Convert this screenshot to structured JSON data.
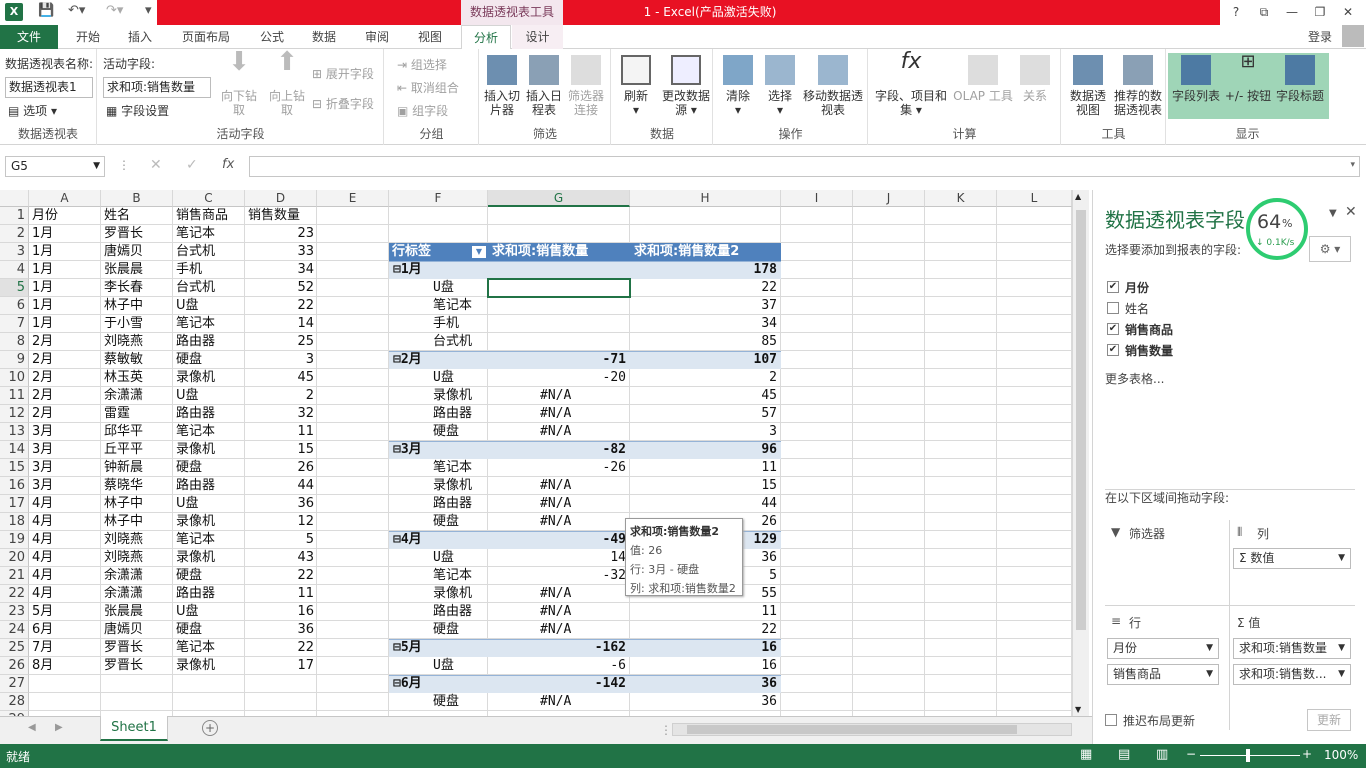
{
  "title": {
    "context_tools": "数据透视表工具",
    "window": "1 -   Excel(产品激活失败)",
    "login": "登录"
  },
  "tabs": [
    "文件",
    "开始",
    "插入",
    "页面布局",
    "公式",
    "数据",
    "审阅",
    "视图",
    "分析",
    "设计"
  ],
  "ribbon": {
    "pt_name_label": "数据透视表名称:",
    "pt_name_value": "数据透视表1",
    "options": "选项",
    "group_pivottable": "数据透视表",
    "active_field_label": "活动字段:",
    "active_field_value": "求和项:销售数量",
    "field_settings": "字段设置",
    "drill_down": "向下钻取",
    "drill_up": "向上钻取",
    "expand_field": "展开字段",
    "collapse_field": "折叠字段",
    "group_active_field": "活动字段",
    "group_selection": "组选择",
    "ungroup": "取消组合",
    "group_field": "组字段",
    "group_group": "分组",
    "insert_slicer": "插入切片器",
    "insert_timeline": "插入日程表",
    "filter_connections": "筛选器连接",
    "group_filter": "筛选",
    "refresh": "刷新",
    "change_source": "更改数据源",
    "group_data": "数据",
    "clear": "清除",
    "select": "选择",
    "move_pt": "移动数据透视表",
    "group_actions": "操作",
    "fields_items_sets": "字段、项目和集",
    "olap_tools": "OLAP 工具",
    "relationships": "关系",
    "group_calc": "计算",
    "pivotchart": "数据透视图",
    "recommended_pt": "推荐的数据透视表",
    "group_tools": "工具",
    "field_list": "字段列表",
    "buttons": "+/- 按钮",
    "field_headers": "字段标题",
    "group_show": "显示"
  },
  "formula_bar": {
    "name_box": "G5",
    "fx": "fx"
  },
  "columns": [
    "A",
    "B",
    "C",
    "D",
    "E",
    "F",
    "G",
    "H",
    "I",
    "J",
    "K",
    "L"
  ],
  "source_header": [
    "月份",
    "姓名",
    "销售商品",
    "销售数量"
  ],
  "source_rows": [
    [
      "1月",
      "罗晋长",
      "笔记本",
      "23"
    ],
    [
      "1月",
      "唐嫣贝",
      "台式机",
      "33"
    ],
    [
      "1月",
      "张晨晨",
      "手机",
      "34"
    ],
    [
      "1月",
      "李长春",
      "台式机",
      "52"
    ],
    [
      "1月",
      "林子中",
      "U盘",
      "22"
    ],
    [
      "1月",
      "于小雪",
      "笔记本",
      "14"
    ],
    [
      "2月",
      "刘晓燕",
      "路由器",
      "25"
    ],
    [
      "2月",
      "蔡敏敏",
      "硬盘",
      "3"
    ],
    [
      "2月",
      "林玉英",
      "录像机",
      "45"
    ],
    [
      "2月",
      "余潇潇",
      "U盘",
      "2"
    ],
    [
      "2月",
      "雷霆",
      "路由器",
      "32"
    ],
    [
      "3月",
      "邱华平",
      "笔记本",
      "11"
    ],
    [
      "3月",
      "丘平平",
      "录像机",
      "15"
    ],
    [
      "3月",
      "钟新晨",
      "硬盘",
      "26"
    ],
    [
      "3月",
      "蔡晓华",
      "路由器",
      "44"
    ],
    [
      "4月",
      "林子中",
      "U盘",
      "36"
    ],
    [
      "4月",
      "林子中",
      "录像机",
      "12"
    ],
    [
      "4月",
      "刘晓燕",
      "笔记本",
      "5"
    ],
    [
      "4月",
      "刘晓燕",
      "录像机",
      "43"
    ],
    [
      "4月",
      "余潇潇",
      "硬盘",
      "22"
    ],
    [
      "4月",
      "余潇潇",
      "路由器",
      "11"
    ],
    [
      "5月",
      "张晨晨",
      "U盘",
      "16"
    ],
    [
      "6月",
      "唐嫣贝",
      "硬盘",
      "36"
    ],
    [
      "7月",
      "罗晋长",
      "笔记本",
      "22"
    ],
    [
      "8月",
      "罗晋长",
      "录像机",
      "17"
    ]
  ],
  "pivot": {
    "headers": [
      "行标签",
      "求和项:销售数量",
      "求和项:销售数量2"
    ],
    "rows": [
      {
        "label": "⊟1月",
        "g": "",
        "h": "178",
        "group": true
      },
      {
        "label": "U盘",
        "g": "",
        "h": "22"
      },
      {
        "label": "笔记本",
        "g": "",
        "h": "37"
      },
      {
        "label": "手机",
        "g": "",
        "h": "34"
      },
      {
        "label": "台式机",
        "g": "",
        "h": "85"
      },
      {
        "label": "⊟2月",
        "g": "-71",
        "h": "107",
        "group": true
      },
      {
        "label": "U盘",
        "g": "-20",
        "h": "2"
      },
      {
        "label": "录像机",
        "g": "#N/A",
        "h": "45"
      },
      {
        "label": "路由器",
        "g": "#N/A",
        "h": "57"
      },
      {
        "label": "硬盘",
        "g": "#N/A",
        "h": "3"
      },
      {
        "label": "⊟3月",
        "g": "-82",
        "h": "96",
        "group": true
      },
      {
        "label": "笔记本",
        "g": "-26",
        "h": "11"
      },
      {
        "label": "录像机",
        "g": "#N/A",
        "h": "15"
      },
      {
        "label": "路由器",
        "g": "#N/A",
        "h": "44"
      },
      {
        "label": "硬盘",
        "g": "#N/A",
        "h": "26"
      },
      {
        "label": "⊟4月",
        "g": "-49",
        "h": "129",
        "group": true
      },
      {
        "label": "U盘",
        "g": "14",
        "h": "36"
      },
      {
        "label": "笔记本",
        "g": "-32",
        "h": "5"
      },
      {
        "label": "录像机",
        "g": "#N/A",
        "h": "55"
      },
      {
        "label": "路由器",
        "g": "#N/A",
        "h": "11"
      },
      {
        "label": "硬盘",
        "g": "#N/A",
        "h": "22"
      },
      {
        "label": "⊟5月",
        "g": "-162",
        "h": "16",
        "group": true
      },
      {
        "label": "U盘",
        "g": "-6",
        "h": "16"
      },
      {
        "label": "⊟6月",
        "g": "-142",
        "h": "36",
        "group": true
      },
      {
        "label": "硬盘",
        "g": "#N/A",
        "h": "36"
      }
    ]
  },
  "tooltip": {
    "title": "求和项:销售数量2",
    "value": "值: 26",
    "row": "行: 3月 - 硬盘",
    "col": "列: 求和项:销售数量2"
  },
  "sheet_tab": "Sheet1",
  "status": {
    "ready": "就绪",
    "zoom": "100%"
  },
  "pane": {
    "title": "数据透视表字段",
    "subtitle": "选择要添加到报表的字段:",
    "fields": [
      {
        "name": "月份",
        "checked": true
      },
      {
        "name": "姓名",
        "checked": false
      },
      {
        "name": "销售商品",
        "checked": true
      },
      {
        "name": "销售数量",
        "checked": true
      }
    ],
    "more_tables": "更多表格...",
    "drag_label": "在以下区域间拖动字段:",
    "filters": "筛选器",
    "columns": "列",
    "col_value": "Σ 数值",
    "rows": "行",
    "values": "Σ 值",
    "row_items": [
      "月份",
      "销售商品"
    ],
    "value_items": [
      "求和项:销售数量",
      "求和项:销售数..."
    ],
    "defer": "推迟布局更新",
    "update": "更新"
  },
  "badge": {
    "percent": "64",
    "unit": "%",
    "speed": "↓ 0.1K/s"
  }
}
